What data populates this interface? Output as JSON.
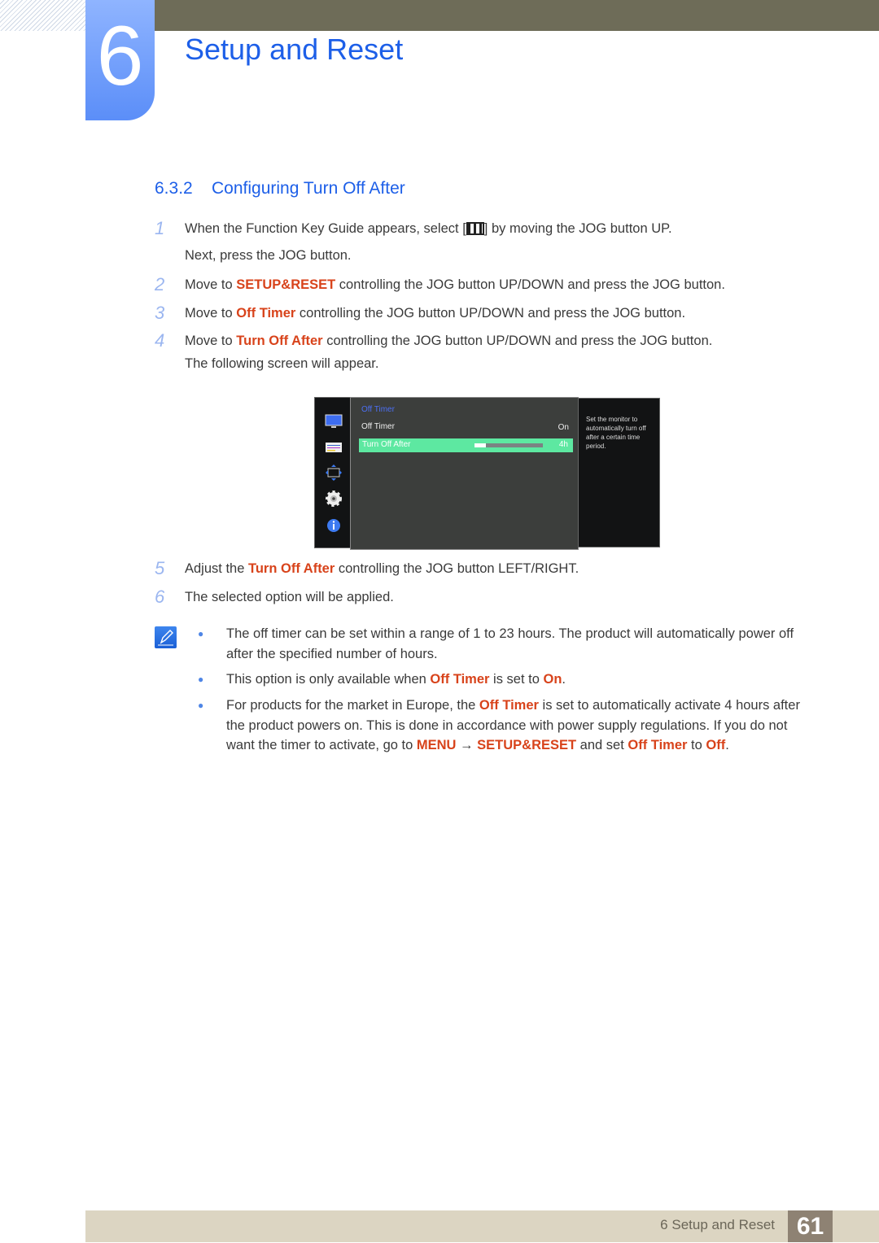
{
  "chapter": {
    "number": "6",
    "title": "Setup and Reset"
  },
  "section": {
    "number": "6.3.2",
    "title": "Configuring Turn Off After"
  },
  "steps": [
    {
      "n": "1",
      "a": "When the Function Key Guide appears, select [",
      "b": "] by moving the JOG button UP.",
      "c": "Next, press the JOG button."
    },
    {
      "n": "2",
      "pre": "Move to ",
      "hl": "SETUP&RESET",
      "post": " controlling the JOG button UP/DOWN and press the JOG button."
    },
    {
      "n": "3",
      "pre": "Move to ",
      "hl": "Off Timer",
      "post": " controlling the JOG button UP/DOWN and press the JOG button."
    },
    {
      "n": "4",
      "pre": "Move to ",
      "hl": "Turn Off After",
      "post": " controlling the JOG button UP/DOWN and press the JOG button.",
      "c": "The following screen will appear."
    },
    {
      "n": "5",
      "pre": "Adjust the ",
      "hl": "Turn Off After",
      "post": " controlling the JOG button LEFT/RIGHT."
    },
    {
      "n": "6",
      "text": "The selected option will be applied."
    }
  ],
  "osd": {
    "header": "Off Timer",
    "rows": [
      {
        "label": "Off Timer",
        "value": "On"
      }
    ],
    "selected": {
      "label": "Turn Off After",
      "value": "4h",
      "progress_fraction": 0.17
    },
    "help": "Set the monitor to automatically turn off after a certain time period.",
    "side_icons": [
      "monitor-icon",
      "picture-settings-icon",
      "position-icon",
      "gear-icon",
      "info-icon"
    ]
  },
  "notes": {
    "b1": "The off timer can be set within a range of 1 to 23 hours. The product will automatically power off after the specified number of hours.",
    "b2": {
      "pre": "This option is only available when ",
      "hl1": "Off Timer",
      "mid": " is set to ",
      "hl2": "On",
      "post": "."
    },
    "b3": {
      "a": "For products for the market in Europe, the ",
      "hl1": "Off Timer",
      "b": " is set to automatically activate 4 hours after the product powers on. This is done in accordance with power supply regulations. If you do not want the timer to activate, go to ",
      "hl2": "MENU",
      "arrow": " → ",
      "hl3": "SETUP&RESET",
      "c": " and set ",
      "hl4": "Off Timer",
      "d": " to ",
      "hl5": "Off",
      "e": "."
    }
  },
  "footer": {
    "text": "6 Setup and Reset",
    "page": "61"
  }
}
